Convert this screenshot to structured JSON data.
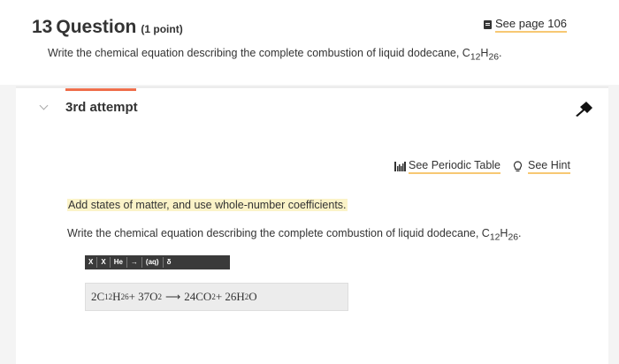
{
  "question": {
    "number": "13",
    "word": "Question",
    "points": "(1 point)",
    "see_page": "See page 106",
    "text": "Write the chemical equation describing the complete combustion of liquid dodecane, ",
    "formula": {
      "c": "C",
      "c_sub": "12",
      "h": "H",
      "h_sub": "26",
      "end": "."
    }
  },
  "attempt": {
    "label": "3rd attempt"
  },
  "tools": {
    "periodic_table": "See Periodic Table",
    "hint": "See Hint"
  },
  "instruction": "Add states of matter, and use whole-number coefficients.",
  "prompt": {
    "text": "Write the chemical equation describing the complete combustion of liquid dodecane, ",
    "formula": {
      "c": "C",
      "c_sub": "12",
      "h": "H",
      "h_sub": "26",
      "end": "."
    }
  },
  "toolbar": {
    "superscript": "X",
    "subscript": "X",
    "element": "He",
    "arrow": "→",
    "state": "(aq)",
    "delta": "δ"
  },
  "answer": {
    "coef1": "2C",
    "sub1": "12",
    "h1": "H",
    "sub2": "26",
    "plus1": " + 37O",
    "sub3": "2",
    "arrow": "⟶",
    "coef2": "24CO",
    "sub4": "2",
    "plus2": " + 26H",
    "sub5": "2",
    "end": "O"
  }
}
